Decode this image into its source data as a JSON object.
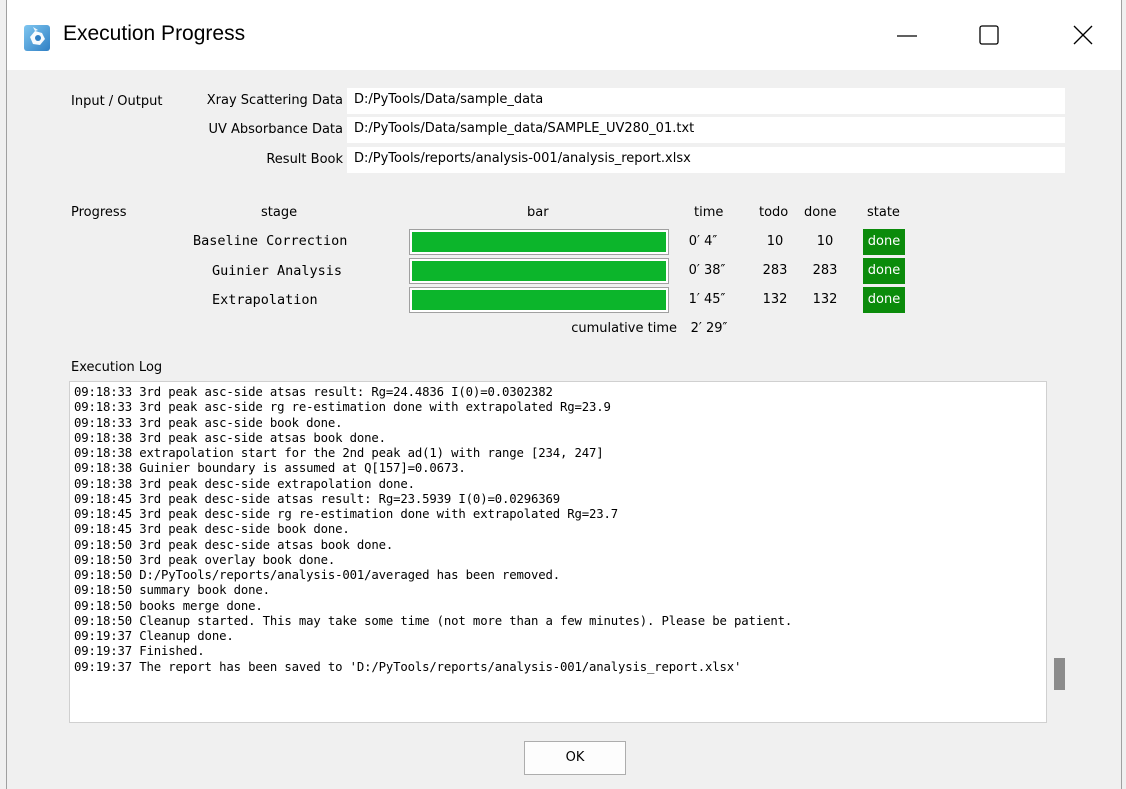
{
  "window": {
    "title": "Execution Progress",
    "icon": "app-icon",
    "controls": [
      "minimize-icon",
      "maximize-icon",
      "close-icon"
    ]
  },
  "io": {
    "section_label": "Input / Output",
    "rows": [
      {
        "label": "Xray Scattering Data",
        "value": "D:/PyTools/Data/sample_data"
      },
      {
        "label": "UV Absorbance Data",
        "value": "D:/PyTools/Data/sample_data/SAMPLE_UV280_01.txt"
      },
      {
        "label": "Result Book",
        "value": "D:/PyTools/reports/analysis-001/analysis_report.xlsx"
      }
    ]
  },
  "progress": {
    "section_label": "Progress",
    "headers": {
      "stage": "stage",
      "bar": "bar",
      "time": "time",
      "todo": "todo",
      "done": "done",
      "state": "state"
    },
    "rows": [
      {
        "stage": "Baseline Correction",
        "progress": 1.0,
        "time": "0′  4″",
        "todo": "10",
        "done": "10",
        "state": "done"
      },
      {
        "stage": "Guinier Analysis",
        "progress": 1.0,
        "time": "0′ 38″",
        "todo": "283",
        "done": "283",
        "state": "done"
      },
      {
        "stage": "Extrapolation",
        "progress": 1.0,
        "time": "1′ 45″",
        "todo": "132",
        "done": "132",
        "state": "done"
      }
    ],
    "cumulative_label": "cumulative time",
    "cumulative_value": "2′ 29″",
    "done_color": "#0b8b0b",
    "bar_color": "#0cb52b"
  },
  "log": {
    "section_label": "Execution Log",
    "lines": [
      "09:18:33 3rd peak asc-side atsas result: Rg=24.4836 I(0)=0.0302382",
      "09:18:33 3rd peak asc-side rg re-estimation done with extrapolated Rg=23.9",
      "09:18:33 3rd peak asc-side book done.",
      "09:18:38 3rd peak asc-side atsas book done.",
      "09:18:38 extrapolation start for the 2nd peak ad(1) with range [234, 247]",
      "09:18:38 Guinier boundary is assumed at Q[157]=0.0673.",
      "09:18:38 3rd peak desc-side extrapolation done.",
      "09:18:45 3rd peak desc-side atsas result: Rg=23.5939 I(0)=0.0296369",
      "09:18:45 3rd peak desc-side rg re-estimation done with extrapolated Rg=23.7",
      "09:18:45 3rd peak desc-side book done.",
      "09:18:50 3rd peak desc-side atsas book done.",
      "09:18:50 3rd peak overlay book done.",
      "09:18:50 D:/PyTools/reports/analysis-001/averaged has been removed.",
      "09:18:50 summary book done.",
      "09:18:50 books merge done.",
      "09:18:50 Cleanup started. This may take some time (not more than a few minutes). Please be patient.",
      "09:19:37 Cleanup done.",
      "09:19:37 Finished.",
      "09:19:37 The report has been saved to 'D:/PyTools/reports/analysis-001/analysis_report.xlsx'"
    ]
  },
  "ok_button": {
    "label": "OK"
  }
}
